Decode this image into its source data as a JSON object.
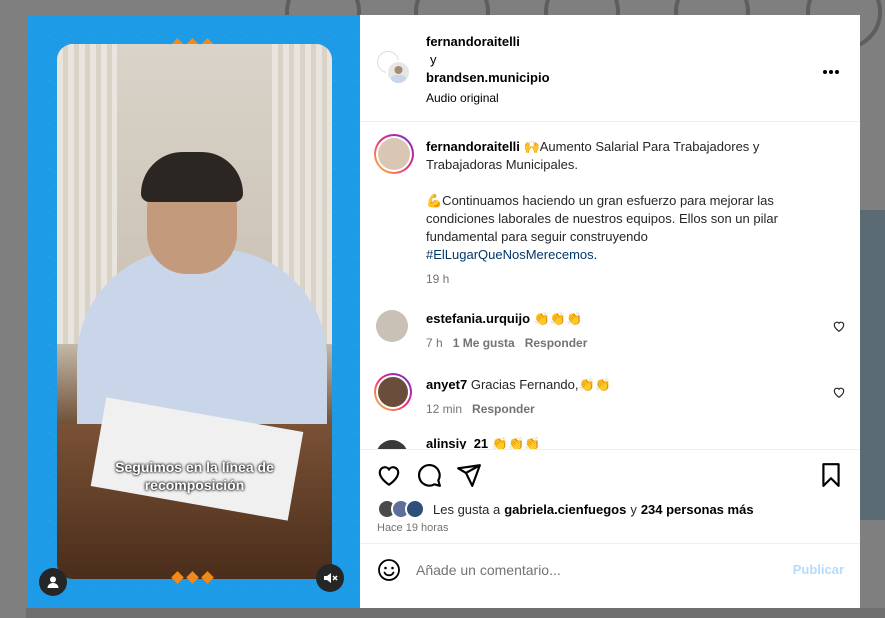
{
  "header": {
    "user1": "fernandoraitelli",
    "joiner": "y",
    "user2": "brandsen.municipio",
    "audio": "Audio original",
    "more_icon": "more-horizontal-icon"
  },
  "media": {
    "caption_line1": "Seguimos en la línea de",
    "caption_line2": "recomposición",
    "accent": "#1e9be6"
  },
  "post": {
    "username": "fernandoraitelli",
    "line1": "🙌Aumento Salarial Para Trabajadores y",
    "line2": "Trabajadoras Municipales.",
    "line3": "💪Continuamos haciendo un gran esfuerzo para mejorar las",
    "line4": "condiciones laborales de nuestros equipos. Ellos son un pilar",
    "line5": "fundamental para seguir construyendo",
    "hashtag": "#ElLugarQueNosMerecemos",
    "hashtag_end": ".",
    "time": "19 h"
  },
  "comments": [
    {
      "username": "estefania.urquijo",
      "text": "👏👏👏",
      "time": "7 h",
      "likes": "1 Me gusta",
      "reply": "Responder"
    },
    {
      "username": "anyet7",
      "text": "Gracias Fernando,👏👏",
      "time": "12 min",
      "reply": "Responder"
    },
    {
      "username": "alinsiy_21",
      "text": "👏👏👏"
    }
  ],
  "likes": {
    "prefix": "Les gusta a",
    "user": "gabriela.cienfuegos",
    "and": "y",
    "count": "234 personas más",
    "time": "Hace 19 horas"
  },
  "composer": {
    "placeholder": "Añade un comentario...",
    "publish": "Publicar"
  },
  "colors": {
    "link": "#00376b",
    "publish_disabled": "#b3dbff"
  }
}
